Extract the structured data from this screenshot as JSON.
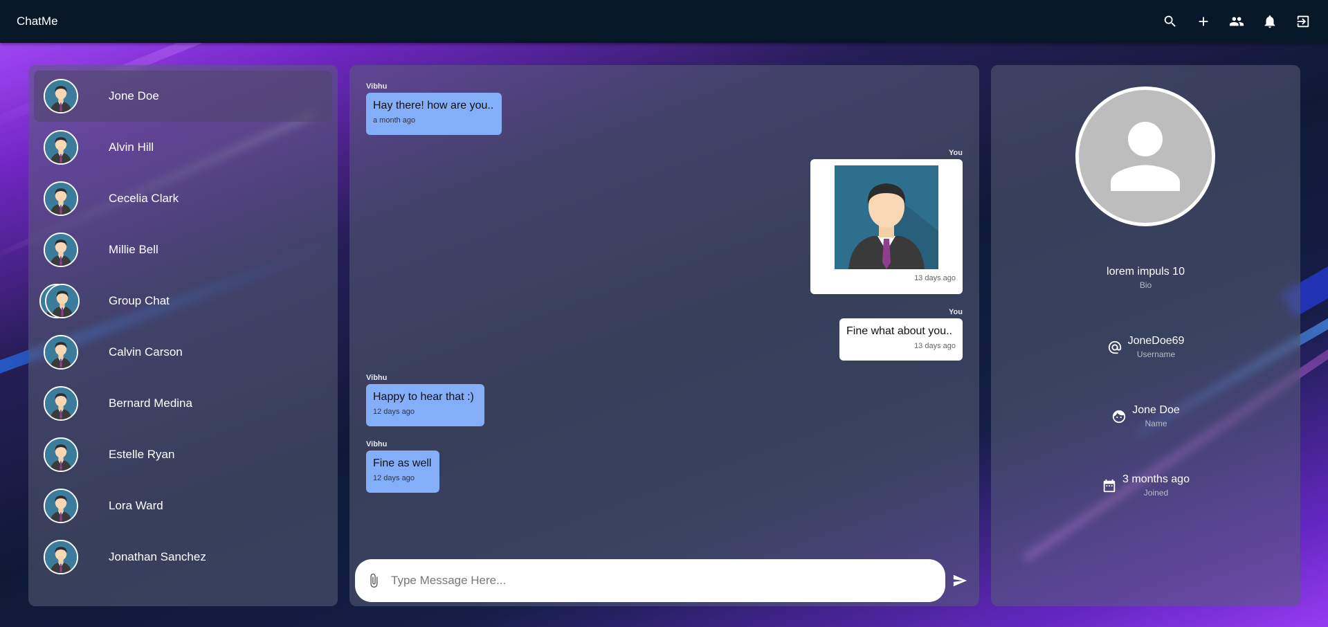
{
  "app": {
    "title": "ChatMe"
  },
  "topbar": {
    "icons": [
      "search-icon",
      "add-icon",
      "people-icon",
      "bell-icon",
      "logout-icon"
    ]
  },
  "contacts": [
    {
      "name": "Jone Doe",
      "active": true
    },
    {
      "name": "Alvin Hill"
    },
    {
      "name": "Cecelia Clark"
    },
    {
      "name": "Millie Bell"
    },
    {
      "name": "Group Chat",
      "group": true
    },
    {
      "name": "Calvin Carson"
    },
    {
      "name": "Bernard Medina"
    },
    {
      "name": "Estelle Ryan"
    },
    {
      "name": "Lora Ward"
    },
    {
      "name": "Jonathan Sanchez"
    }
  ],
  "messages": [
    {
      "sender": "Vibhu",
      "text": "Hay there! how are you..",
      "time": "a month ago",
      "mine": false
    },
    {
      "sender": "You",
      "image": "person-avatar",
      "time": "13 days ago",
      "mine": true
    },
    {
      "sender": "You",
      "text": "Fine what about you..",
      "time": "13 days ago",
      "mine": true
    },
    {
      "sender": "Vibhu",
      "text": "Happy to hear that :)",
      "time": "12 days ago",
      "mine": false
    },
    {
      "sender": "Vibhu",
      "text": "Fine as well",
      "time": "12 days ago",
      "mine": false
    }
  ],
  "composer": {
    "placeholder": "Type Message Here..."
  },
  "profile": {
    "bio_value": "lorem impuls 10",
    "bio_label": "Bio",
    "username_value": "JoneDoe69",
    "username_label": "Username",
    "name_value": "Jone Doe",
    "name_label": "Name",
    "joined_value": "3 months ago",
    "joined_label": "Joined"
  },
  "colors": {
    "topbar": "#061728",
    "bubble_them": "#84aef7",
    "bubble_me": "#ffffff",
    "accent": "#a848ff"
  }
}
